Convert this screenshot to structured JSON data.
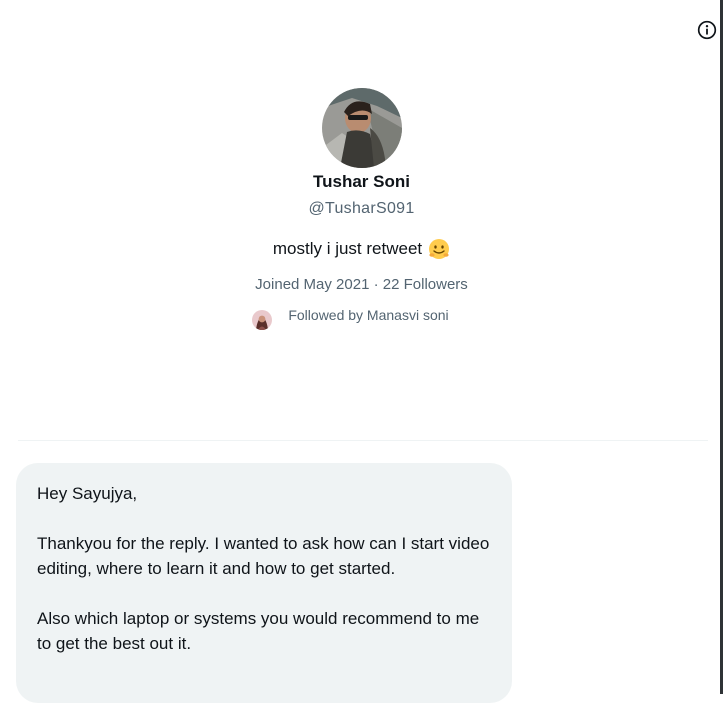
{
  "profile": {
    "name": "Tushar Soni",
    "handle": "@TusharS091",
    "bio": "mostly i just retweet",
    "bio_emoji": "smiling-face-emoji",
    "joined": "Joined May 2021",
    "separator": " · ",
    "followers": "22 Followers",
    "followed_by": "Followed by Manasvi soni"
  },
  "message": {
    "greeting": "Hey Sayujya,",
    "paragraph1": "Thankyou for the reply. I wanted to ask how can I start video editing, where to learn it and how to get started.",
    "paragraph2": "Also which laptop or systems you would recommend to me to get the best out it."
  },
  "icons": {
    "info": "info-icon"
  },
  "colors": {
    "text_primary": "#0f1419",
    "text_secondary": "#536471",
    "bubble_bg": "#eff3f4",
    "emoji": "#ffcc4d"
  }
}
